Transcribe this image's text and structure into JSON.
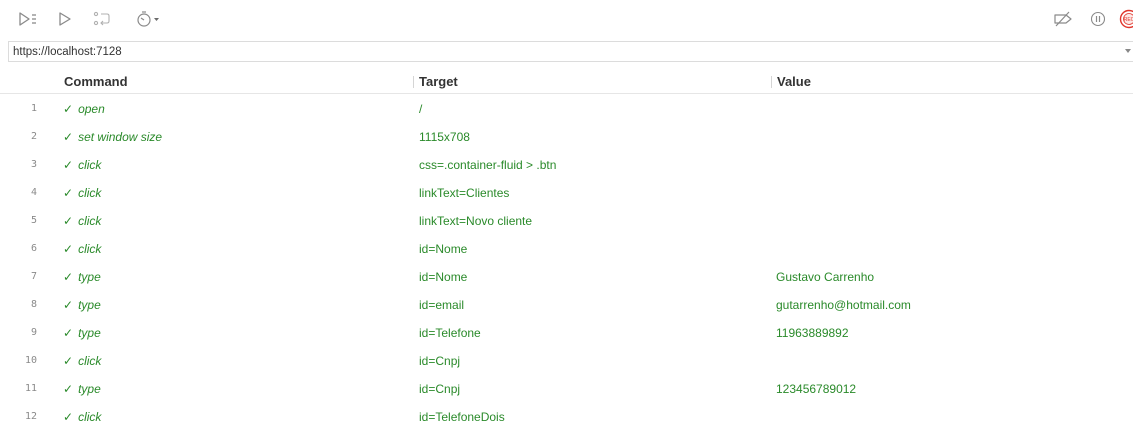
{
  "toolbar": {
    "run_all_icon": "play-list-icon",
    "run_icon": "play-icon",
    "step_icon": "step-over-icon",
    "speed_icon": "stopwatch-icon",
    "breakpoints_icon": "disable-breakpoints-icon",
    "pause_icon": "pause-on-exception-icon",
    "record_icon": "record-icon",
    "record_color": "#e0352b"
  },
  "url": {
    "value": "https://localhost:7128"
  },
  "table": {
    "headers": {
      "command": "Command",
      "target": "Target",
      "value": "Value"
    },
    "check_glyph": "✓",
    "rows": [
      {
        "index": "1",
        "command": "open",
        "target": "/",
        "value": ""
      },
      {
        "index": "2",
        "command": "set window size",
        "target": "1115x708",
        "value": ""
      },
      {
        "index": "3",
        "command": "click",
        "target": "css=.container-fluid > .btn",
        "value": ""
      },
      {
        "index": "4",
        "command": "click",
        "target": "linkText=Clientes",
        "value": ""
      },
      {
        "index": "5",
        "command": "click",
        "target": "linkText=Novo cliente",
        "value": ""
      },
      {
        "index": "6",
        "command": "click",
        "target": "id=Nome",
        "value": ""
      },
      {
        "index": "7",
        "command": "type",
        "target": "id=Nome",
        "value": "Gustavo Carrenho"
      },
      {
        "index": "8",
        "command": "type",
        "target": "id=email",
        "value": "gutarrenho@hotmail.com"
      },
      {
        "index": "9",
        "command": "type",
        "target": "id=Telefone",
        "value": "11963889892"
      },
      {
        "index": "10",
        "command": "click",
        "target": "id=Cnpj",
        "value": ""
      },
      {
        "index": "11",
        "command": "type",
        "target": "id=Cnpj",
        "value": "123456789012"
      },
      {
        "index": "12",
        "command": "click",
        "target": "id=TelefoneDois",
        "value": ""
      }
    ]
  }
}
